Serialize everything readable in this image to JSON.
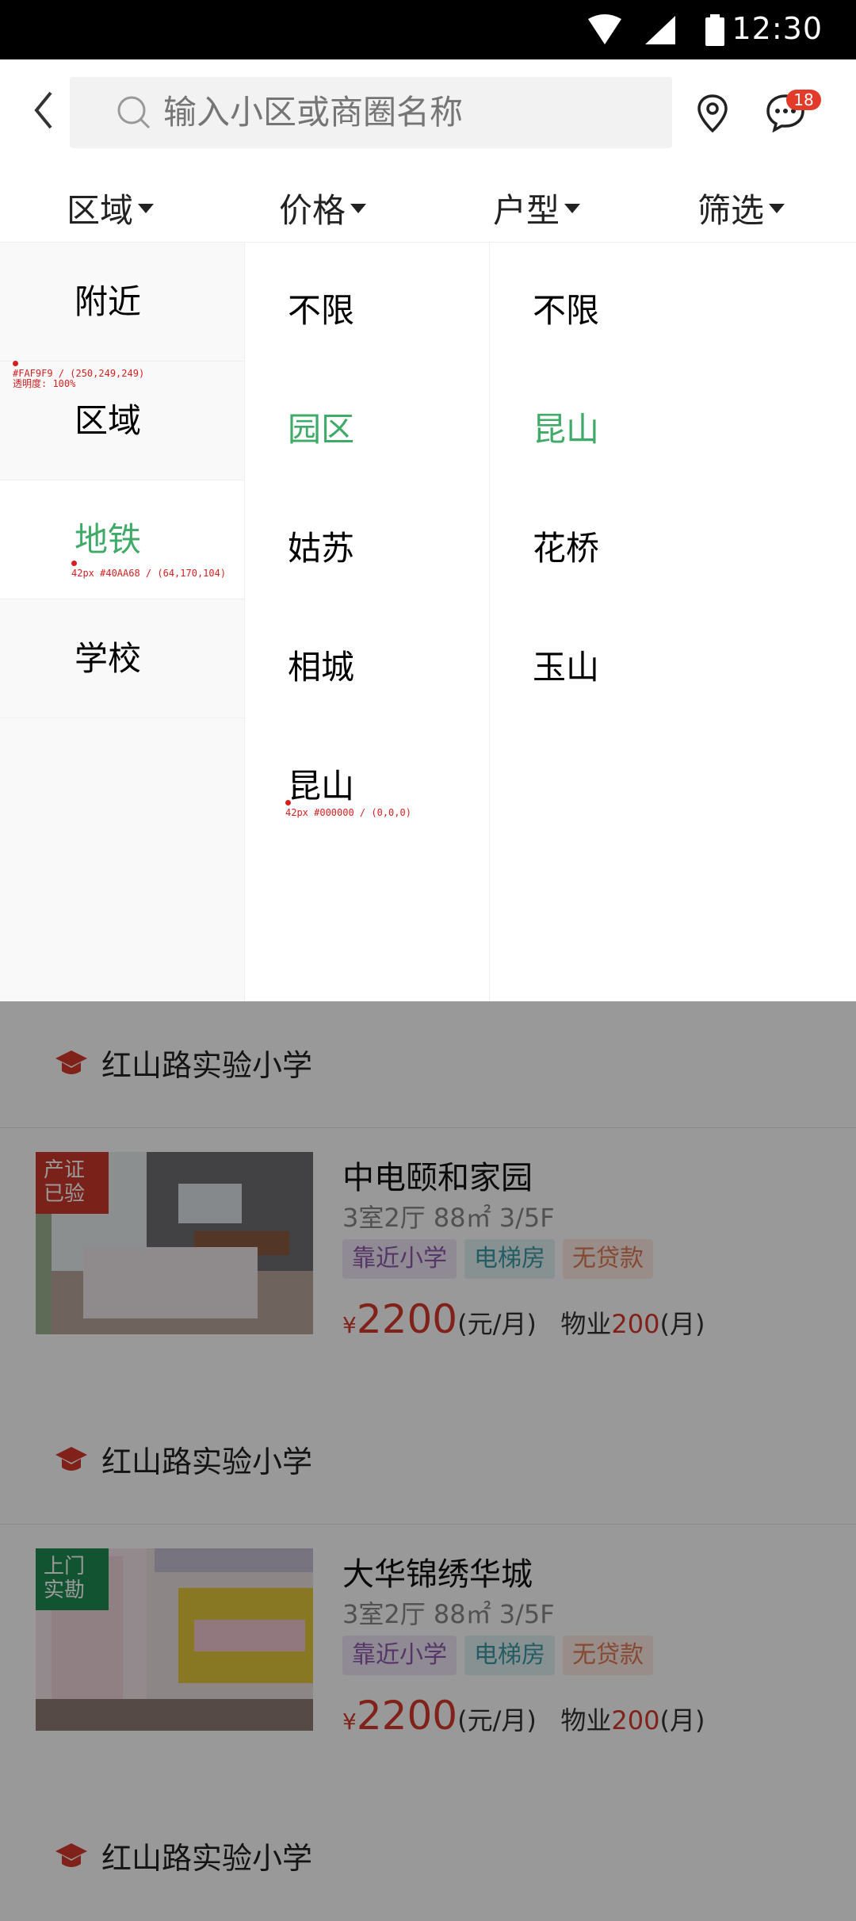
{
  "status_bar": {
    "time": "12:30"
  },
  "header": {
    "search_placeholder": "输入小区或商圈名称",
    "message_badge": "18"
  },
  "filters": [
    {
      "label": "区域"
    },
    {
      "label": "价格"
    },
    {
      "label": "户型"
    },
    {
      "label": "筛选"
    }
  ],
  "panel": {
    "column1": [
      "附近",
      "区域",
      "地铁",
      "学校"
    ],
    "column1_active_index": 2,
    "column2": [
      "不限",
      "园区",
      "姑苏",
      "相城",
      "昆山"
    ],
    "column2_active_index": 1,
    "column3": [
      "不限",
      "昆山",
      "花桥",
      "玉山"
    ],
    "column3_active_index": 1
  },
  "annotations": {
    "a1_line1": "#FAF9F9 / (250,249,249)",
    "a1_line2": "透明度: 100%",
    "a2": "42px #40AA68 / (64,170,104)",
    "a3": "42px #000000 / (0,0,0)"
  },
  "colors": {
    "active_green": "#40AA68",
    "price_red": "#D53A2A",
    "col1_bg": "#FAF9F9"
  },
  "listings": {
    "school_rows": [
      "红山路实验小学",
      "红山路实验小学",
      "红山路实验小学"
    ],
    "items": [
      {
        "corner_tag": [
          "产证",
          "已验"
        ],
        "title": "中电颐和家园",
        "meta": "3室2厅   88㎡  3/5F",
        "tags": [
          "靠近小学",
          "电梯房",
          "无贷款"
        ],
        "price_symbol": "¥",
        "price": "2200",
        "price_unit": "(元/月)",
        "fee_label": "物业",
        "fee": "200",
        "fee_unit": "(月)"
      },
      {
        "corner_tag": [
          "上门",
          "实勘"
        ],
        "title": "大华锦绣华城",
        "meta": "3室2厅   88㎡  3/5F",
        "tags": [
          "靠近小学",
          "电梯房",
          "无贷款"
        ],
        "price_symbol": "¥",
        "price": "2200",
        "price_unit": "(元/月)",
        "fee_label": "物业",
        "fee": "200",
        "fee_unit": "(月)"
      }
    ]
  }
}
